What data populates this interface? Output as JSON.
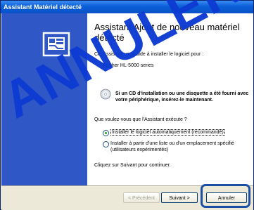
{
  "window": {
    "title": "Assistant Matériel détecté"
  },
  "content": {
    "heading": "Assistant Ajout de nouveau matériel détecté",
    "intro": "Cet Assistant vous aide à installer le logiciel pour :",
    "device": "Brother HL-5000 series",
    "cd_hint": "Si un CD d'installation ou une disquette a été fourni avec votre périphérique, insérez-le maintenant.",
    "question": "Que voulez-vous que l'Assistant exécute ?",
    "options": [
      {
        "label": "Installer le logiciel automatiquement (recommandé)",
        "selected": true
      },
      {
        "label": "Installer à partir d'une liste ou d'un emplacement spécifié (utilisateurs expérimentés)",
        "selected": false
      }
    ],
    "continue_text": "Cliquez sur Suivant pour continuer."
  },
  "buttons": {
    "back": "< Précédent",
    "next": "Suivant >",
    "cancel": "Annuler"
  },
  "stamp": {
    "text": "ANNULER",
    "color": "#0d3bd2"
  },
  "colors": {
    "sidebar": "#2f58c6",
    "titlebar": "#0b5fd8",
    "highlight": "#1a4fa3"
  },
  "icons": [
    "wizard-hardware-icon",
    "cd-icon"
  ]
}
